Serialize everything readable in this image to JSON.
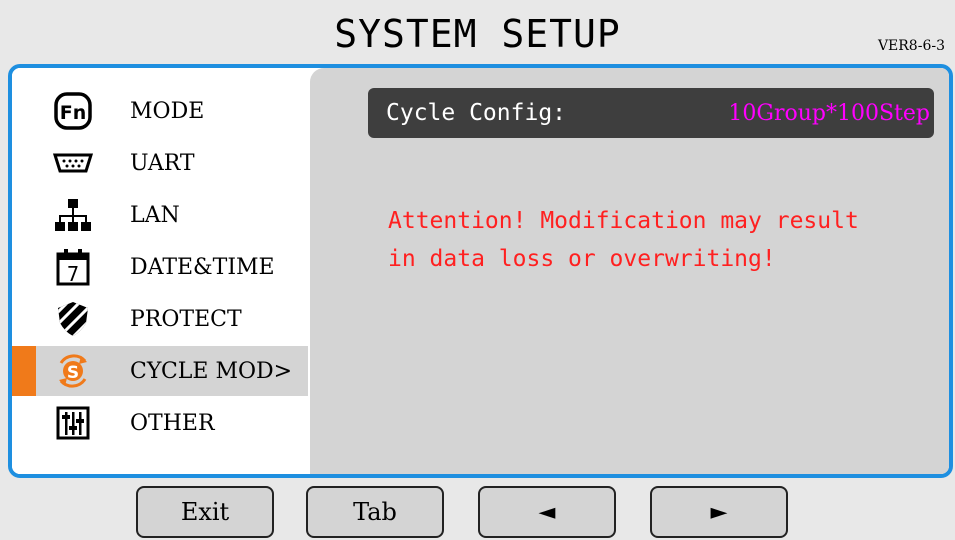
{
  "header": {
    "title": "SYSTEM SETUP",
    "version": "VER8-6-3"
  },
  "sidebar": {
    "items": [
      {
        "label": "MODE",
        "icon": "fn-icon"
      },
      {
        "label": "UART",
        "icon": "serial-port-icon"
      },
      {
        "label": "LAN",
        "icon": "network-icon"
      },
      {
        "label": "DATE&TIME",
        "icon": "calendar-icon"
      },
      {
        "label": "PROTECT",
        "icon": "shield-icon"
      },
      {
        "label": "CYCLE MOD>",
        "icon": "cycle-icon",
        "selected": true
      },
      {
        "label": "OTHER",
        "icon": "sliders-icon"
      }
    ]
  },
  "main": {
    "config_label": "Cycle Config:",
    "config_value": "10Group*100Step",
    "warning_line1": "Attention! Modification may result",
    "warning_line2": "in data loss or overwriting!"
  },
  "buttons": {
    "exit": "Exit",
    "tab": "Tab",
    "left": "◄",
    "right": "►"
  },
  "colors": {
    "frame": "#1e8fe0",
    "selected_bar": "#f07a1a",
    "config_value": "#ff00ff",
    "warning": "#ff2020"
  }
}
